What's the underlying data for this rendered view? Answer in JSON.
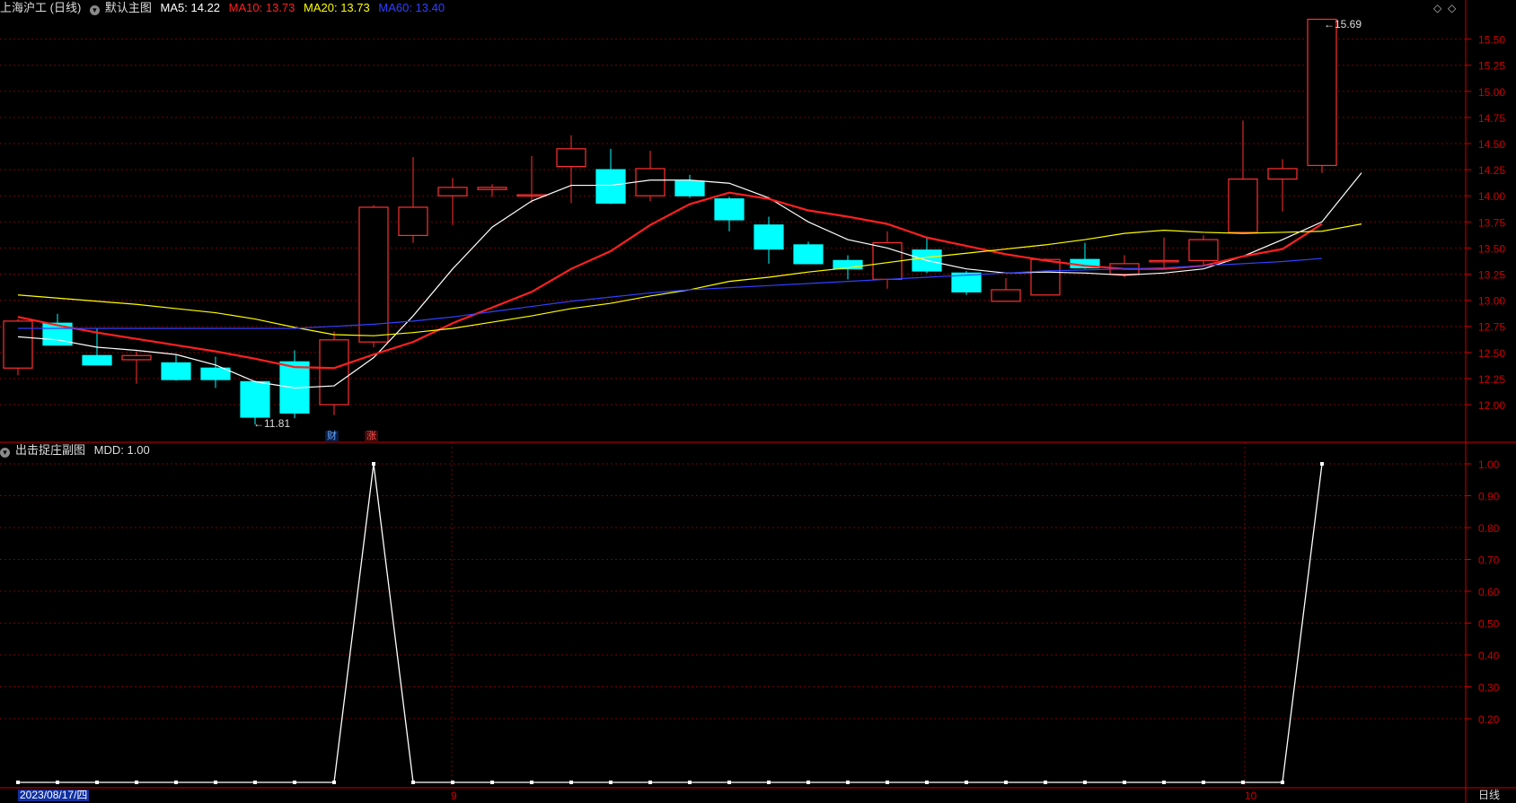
{
  "header": {
    "stock": "上海沪工 (日线)",
    "main_chart": "默认主图",
    "ma": [
      {
        "label": "MA5: 14.22",
        "color": "#ffffff"
      },
      {
        "label": "MA10: 13.73",
        "color": "#ff2020"
      },
      {
        "label": "MA20: 13.73",
        "color": "#ffff00"
      },
      {
        "label": "MA60: 13.40",
        "color": "#3040ff"
      }
    ]
  },
  "sub_header": {
    "name": "出击捉庄副图",
    "value": "MDD: 1.00"
  },
  "annotations": {
    "high": "15.69",
    "low": "11.81",
    "tag_finance": "财",
    "tag_rise": "涨"
  },
  "footer": {
    "date": "2023/08/17/四",
    "month_9": "9",
    "month_10": "10",
    "period": "日线"
  },
  "colors": {
    "up": "#ff3030",
    "down": "#00ffff",
    "grid": "#7a0000",
    "axis": "#cc0000"
  },
  "chart_data": [
    {
      "type": "candlestick",
      "title": "上海沪工 (日线)",
      "y_ticks": [
        12.0,
        12.25,
        12.5,
        12.75,
        13.0,
        13.25,
        13.5,
        13.75,
        14.0,
        14.25,
        14.5,
        14.75,
        15.0,
        15.25,
        15.5
      ],
      "ylim": [
        11.6,
        15.8
      ],
      "candles": [
        {
          "o": 12.35,
          "h": 12.82,
          "l": 12.28,
          "c": 12.8
        },
        {
          "o": 12.78,
          "h": 12.87,
          "l": 12.57,
          "c": 12.57
        },
        {
          "o": 12.47,
          "h": 12.73,
          "l": 12.38,
          "c": 12.38
        },
        {
          "o": 12.43,
          "h": 12.51,
          "l": 12.2,
          "c": 12.47
        },
        {
          "o": 12.4,
          "h": 12.48,
          "l": 12.23,
          "c": 12.24
        },
        {
          "o": 12.35,
          "h": 12.46,
          "l": 12.16,
          "c": 12.24
        },
        {
          "o": 12.22,
          "h": 12.23,
          "l": 11.81,
          "c": 11.88
        },
        {
          "o": 12.41,
          "h": 12.52,
          "l": 11.87,
          "c": 11.92
        },
        {
          "o": 12.0,
          "h": 12.7,
          "l": 11.9,
          "c": 12.62
        },
        {
          "o": 12.6,
          "h": 13.91,
          "l": 12.55,
          "c": 13.89
        },
        {
          "o": 13.62,
          "h": 14.37,
          "l": 13.55,
          "c": 13.89
        },
        {
          "o": 14.0,
          "h": 14.17,
          "l": 13.72,
          "c": 14.08
        },
        {
          "o": 14.06,
          "h": 14.11,
          "l": 13.99,
          "c": 14.08
        },
        {
          "o": 14.0,
          "h": 14.38,
          "l": 13.93,
          "c": 14.01
        },
        {
          "o": 14.28,
          "h": 14.58,
          "l": 13.93,
          "c": 14.45
        },
        {
          "o": 14.25,
          "h": 14.45,
          "l": 13.92,
          "c": 13.93
        },
        {
          "o": 14.0,
          "h": 14.43,
          "l": 13.95,
          "c": 14.26
        },
        {
          "o": 14.14,
          "h": 14.2,
          "l": 13.98,
          "c": 14.0
        },
        {
          "o": 13.97,
          "h": 13.99,
          "l": 13.66,
          "c": 13.77
        },
        {
          "o": 13.72,
          "h": 13.8,
          "l": 13.35,
          "c": 13.49
        },
        {
          "o": 13.53,
          "h": 13.56,
          "l": 13.35,
          "c": 13.35
        },
        {
          "o": 13.38,
          "h": 13.43,
          "l": 13.2,
          "c": 13.3
        },
        {
          "o": 13.2,
          "h": 13.66,
          "l": 13.11,
          "c": 13.55
        },
        {
          "o": 13.48,
          "h": 13.6,
          "l": 13.26,
          "c": 13.28
        },
        {
          "o": 13.26,
          "h": 13.28,
          "l": 13.05,
          "c": 13.08
        },
        {
          "o": 12.99,
          "h": 13.21,
          "l": 12.99,
          "c": 13.1
        },
        {
          "o": 13.05,
          "h": 13.4,
          "l": 13.05,
          "c": 13.39
        },
        {
          "o": 13.39,
          "h": 13.55,
          "l": 13.3,
          "c": 13.31
        },
        {
          "o": 13.25,
          "h": 13.43,
          "l": 13.22,
          "c": 13.35
        },
        {
          "o": 13.38,
          "h": 13.6,
          "l": 13.3,
          "c": 13.38
        },
        {
          "o": 13.38,
          "h": 13.62,
          "l": 13.33,
          "c": 13.58
        },
        {
          "o": 13.65,
          "h": 14.72,
          "l": 13.64,
          "c": 14.16
        },
        {
          "o": 14.16,
          "h": 14.35,
          "l": 13.85,
          "c": 14.26
        },
        {
          "o": 14.29,
          "h": 15.69,
          "l": 14.22,
          "c": 15.69
        }
      ],
      "series": [
        {
          "name": "MA5",
          "color": "#ffffff",
          "values": [
            12.65,
            12.62,
            12.55,
            12.52,
            12.48,
            12.38,
            12.22,
            12.16,
            12.18,
            12.45,
            12.85,
            13.3,
            13.7,
            13.95,
            14.1,
            14.1,
            14.15,
            14.15,
            14.12,
            13.98,
            13.75,
            13.58,
            13.5,
            13.38,
            13.3,
            13.26,
            13.27,
            13.26,
            13.24,
            13.26,
            13.3,
            13.42,
            13.58,
            13.75,
            14.22
          ]
        },
        {
          "name": "MA10",
          "color": "#ff2020",
          "values": [
            12.84,
            12.76,
            12.69,
            12.63,
            12.57,
            12.51,
            12.44,
            12.36,
            12.35,
            12.48,
            12.6,
            12.78,
            12.93,
            13.08,
            13.3,
            13.47,
            13.72,
            13.92,
            14.03,
            13.97,
            13.86,
            13.8,
            13.73,
            13.6,
            13.52,
            13.44,
            13.38,
            13.33,
            13.3,
            13.3,
            13.33,
            13.42,
            13.49,
            13.73
          ]
        },
        {
          "name": "MA20",
          "color": "#ffff00",
          "values": [
            13.05,
            13.02,
            12.99,
            12.96,
            12.92,
            12.88,
            12.82,
            12.74,
            12.67,
            12.66,
            12.69,
            12.73,
            12.79,
            12.85,
            12.92,
            12.97,
            13.04,
            13.1,
            13.18,
            13.22,
            13.27,
            13.31,
            13.36,
            13.41,
            13.45,
            13.49,
            13.53,
            13.58,
            13.64,
            13.67,
            13.65,
            13.64,
            13.65,
            13.66,
            13.73
          ]
        },
        {
          "name": "MA60",
          "color": "#3040ff",
          "values": [
            12.73,
            12.73,
            12.73,
            12.73,
            12.73,
            12.73,
            12.73,
            12.73,
            12.75,
            12.77,
            12.8,
            12.84,
            12.89,
            12.94,
            12.99,
            13.03,
            13.07,
            13.1,
            13.12,
            13.14,
            13.16,
            13.18,
            13.2,
            13.22,
            13.24,
            13.26,
            13.28,
            13.29,
            13.3,
            13.31,
            13.33,
            13.35,
            13.37,
            13.4
          ]
        }
      ]
    },
    {
      "type": "line",
      "title": "出击捉庄副图",
      "series": [
        {
          "name": "MDD",
          "values": [
            0,
            0,
            0,
            0,
            0,
            0,
            0,
            0,
            0,
            1,
            0,
            0,
            0,
            0,
            0,
            0,
            0,
            0,
            0,
            0,
            0,
            0,
            0,
            0,
            0,
            0,
            0,
            0,
            0,
            0,
            0,
            0,
            0,
            1
          ]
        }
      ],
      "y_ticks": [
        0.2,
        0.3,
        0.4,
        0.5,
        0.6,
        0.7,
        0.8,
        0.9,
        1.0
      ],
      "ylim": [
        0,
        1.02
      ]
    }
  ]
}
